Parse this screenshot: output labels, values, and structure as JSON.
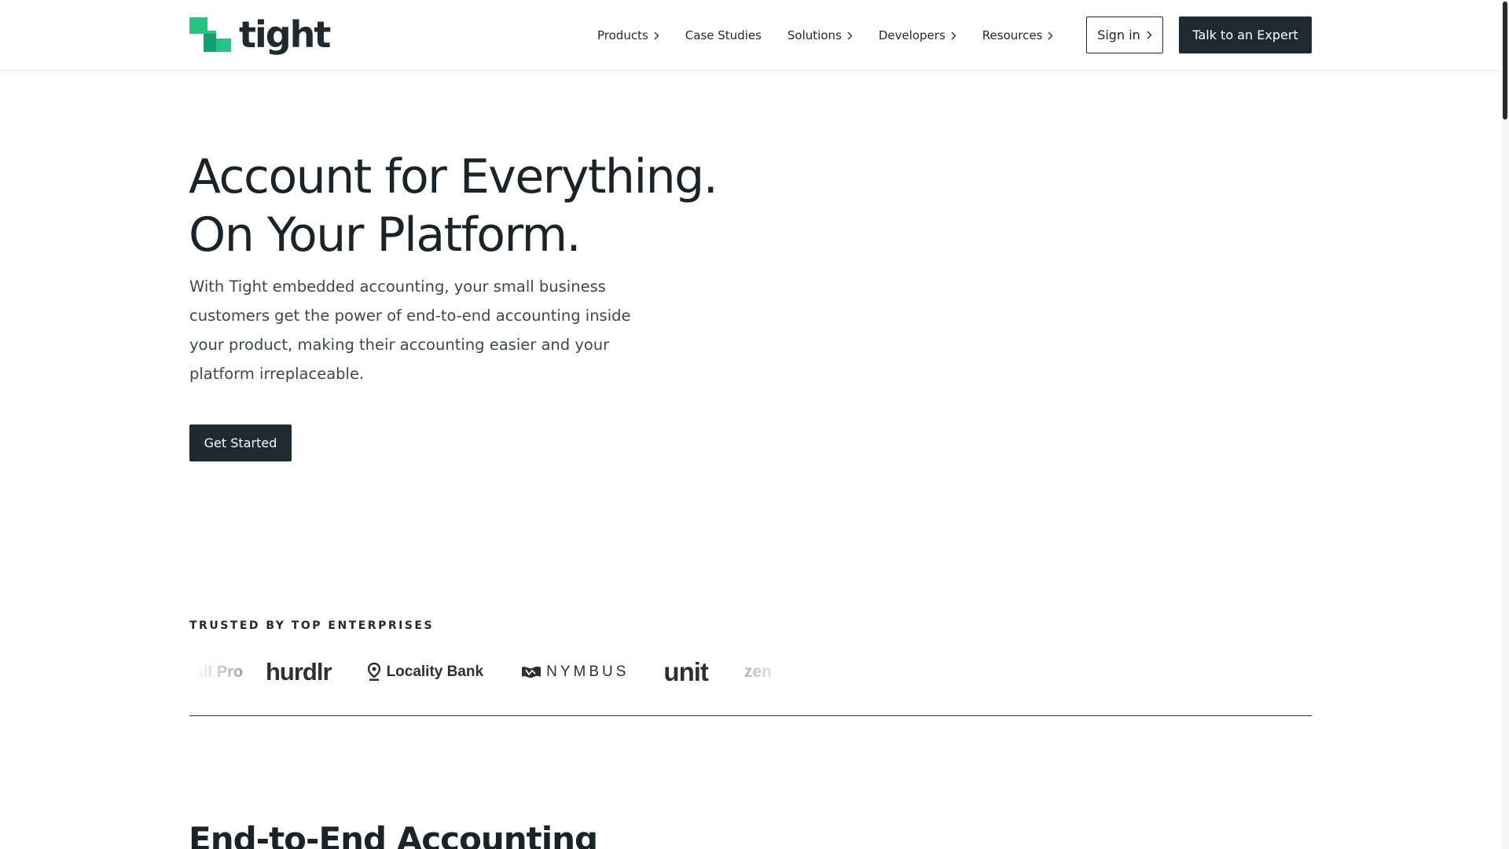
{
  "brand": {
    "name": "tight",
    "accent": "#27c483",
    "dark": "#1e2a2f"
  },
  "nav": {
    "items": [
      {
        "label": "Products",
        "has_chevron": true
      },
      {
        "label": "Case Studies",
        "has_chevron": false
      },
      {
        "label": "Solutions",
        "has_chevron": true
      },
      {
        "label": "Developers",
        "has_chevron": true
      },
      {
        "label": "Resources",
        "has_chevron": true
      }
    ],
    "sign_in": "Sign in",
    "cta": "Talk to an Expert"
  },
  "hero": {
    "title_line1": "Account for Everything.",
    "title_line2": "On Your Platform.",
    "description": "With Tight embedded accounting, your small business customers get the power of end-to-end accounting inside your product, making their accounting easier and your platform irreplaceable.",
    "cta": "Get Started"
  },
  "trusted": {
    "label": "TRUSTED BY TOP ENTERPRISES",
    "logos": [
      {
        "name": "all Pro",
        "icon": "none"
      },
      {
        "name": "hurdlr",
        "icon": "none"
      },
      {
        "name": "Locality Bank",
        "icon": "location-pin-icon"
      },
      {
        "name": "NYMBUS",
        "icon": "nymbus-flag-icon"
      },
      {
        "name": "unit",
        "icon": "none"
      },
      {
        "name": "zen",
        "icon": "none"
      }
    ]
  },
  "section": {
    "title": "End-to-End Accounting"
  }
}
